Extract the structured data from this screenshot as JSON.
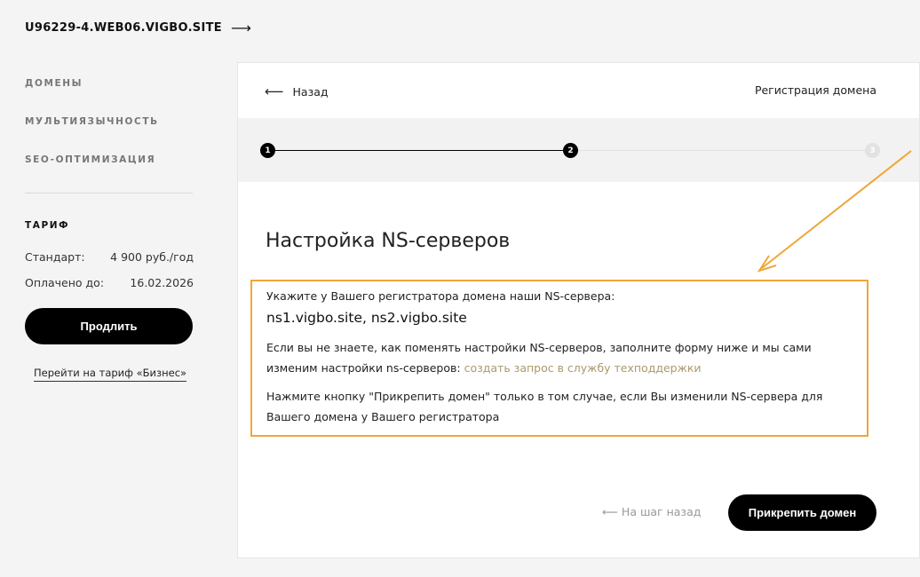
{
  "site": {
    "title": "U96229-4.WEB06.VIGBO.SITE",
    "arrow": "⟶"
  },
  "sidebar": {
    "items": [
      {
        "label": "ДОМЕНЫ"
      },
      {
        "label": "МУЛЬТИЯЗЫЧНОСТЬ"
      },
      {
        "label": "SEO-ОПТИМИЗАЦИЯ"
      }
    ],
    "tariff": {
      "title": "ТАРИФ",
      "plan_label": "Стандарт:",
      "plan_price": "4 900 руб./год",
      "paid_label": "Оплачено до:",
      "paid_date": "16.02.2026",
      "extend_button": "Продлить",
      "switch_link": "Перейти на тариф «Бизнес»"
    }
  },
  "panel": {
    "back_label": "Назад",
    "back_arrow": "⟵",
    "header_title": "Регистрация домена",
    "steps": {
      "step1": "1",
      "step2": "2",
      "step3": "3",
      "current": 2,
      "total": 3
    },
    "content_title": "Настройка NS-серверов",
    "info": {
      "intro": "Укажите у Вашего регистратора домена наши NS-сервера:",
      "ns_servers": "ns1.vigbo.site, ns2.vigbo.site",
      "para2": "Если вы не знаете, как поменять настройки NS-серверов, заполните форму ниже и мы сами изменим настройки ns-серверов: ",
      "support_link": "создать запрос в службу техподдержки",
      "para3": "Нажмите кнопку \"Прикрепить домен\" только в том случае, если Вы изменили NS-сервера для Вашего домена у Вашего регистратора"
    },
    "step_back": "На шаг назад",
    "step_back_arrow": "⟵",
    "attach_button": "Прикрепить домен"
  },
  "colors": {
    "accent_orange": "#f0a63a",
    "link_gold": "#a99a6b",
    "button_black": "#000000"
  }
}
